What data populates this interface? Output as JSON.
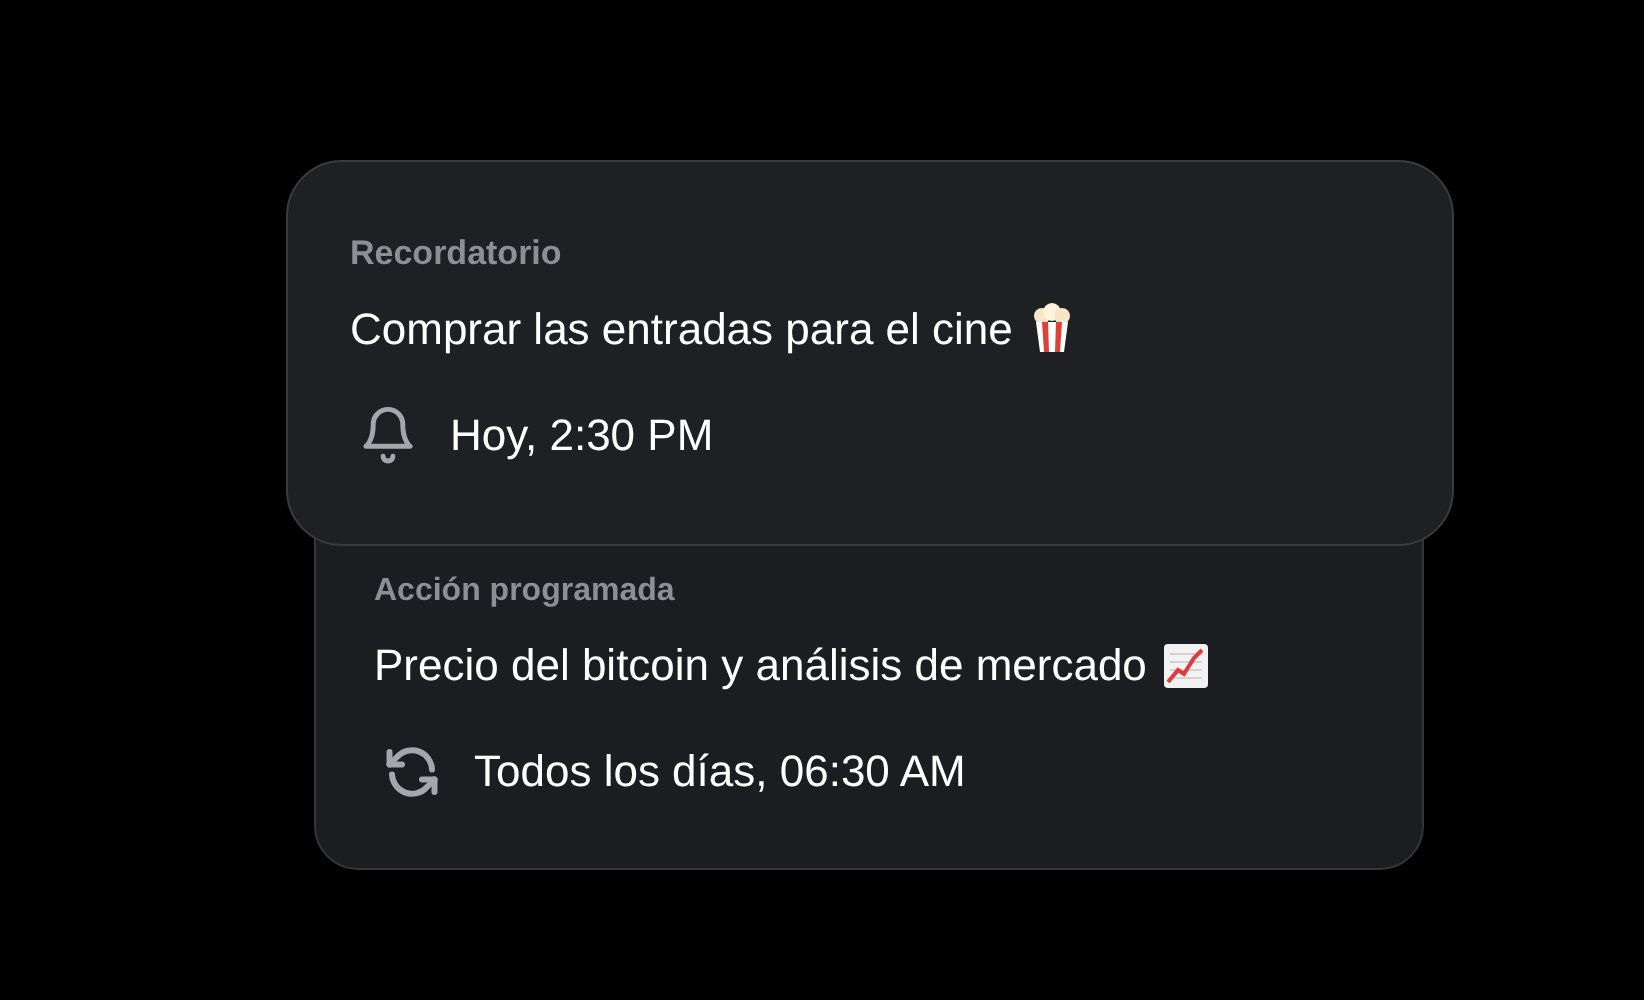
{
  "cards": [
    {
      "kind": "reminder",
      "label": "Recordatorio",
      "title": "Comprar las entradas para el cine",
      "time": "Hoy, 2:30 PM"
    },
    {
      "kind": "scheduled",
      "label": "Acción programada",
      "title": "Precio del bitcoin y análisis de mercado",
      "time": "Todos los días, 06:30 AM"
    }
  ]
}
